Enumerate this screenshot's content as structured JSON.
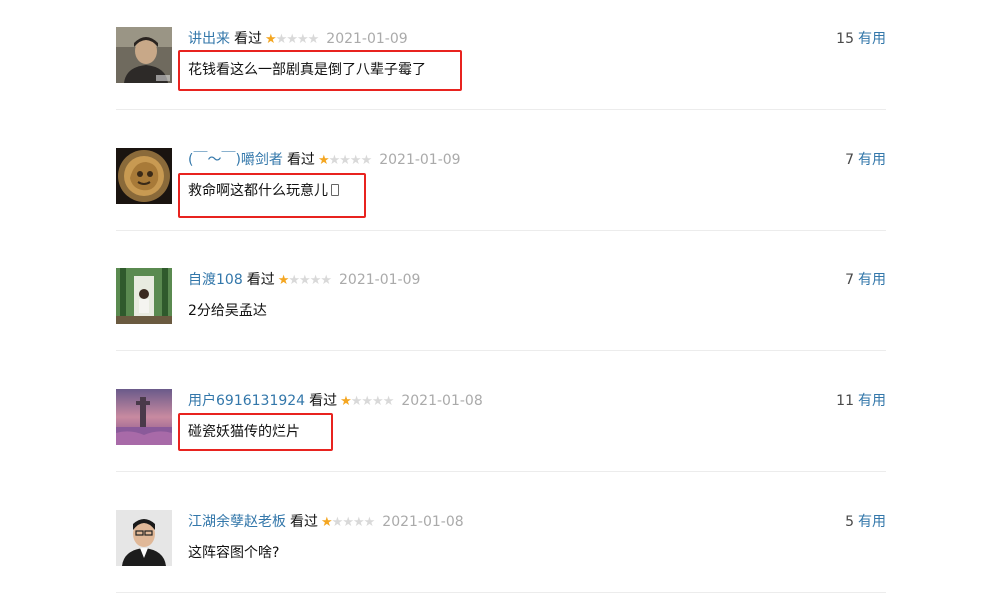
{
  "colors": {
    "link": "#3377aa",
    "star_on": "#f4a621",
    "star_off": "#d9d9d9",
    "date": "#aaaaaa",
    "highlight_box": "#e8231f"
  },
  "icons": {
    "star_filled": "★",
    "star_empty": "★"
  },
  "comments": [
    {
      "username": "讲出来",
      "status": "看过",
      "rating": 1,
      "rating_max": 5,
      "date": "2021-01-09",
      "useful_count": "15",
      "useful_label": "有用",
      "content": "花钱看这么一部剧真是倒了八辈子霉了",
      "highlighted": true
    },
    {
      "username": "(￣～￣)嚼剑者",
      "status": "看过",
      "rating": 1,
      "rating_max": 5,
      "date": "2021-01-09",
      "useful_count": "7",
      "useful_label": "有用",
      "content": "救命啊这都什么玩意儿",
      "highlighted": true
    },
    {
      "username": "自渡108",
      "status": "看过",
      "rating": 1,
      "rating_max": 5,
      "date": "2021-01-09",
      "useful_count": "7",
      "useful_label": "有用",
      "content": "2分给吴孟达",
      "highlighted": false
    },
    {
      "username": "用户6916131924",
      "status": "看过",
      "rating": 1,
      "rating_max": 5,
      "date": "2021-01-08",
      "useful_count": "11",
      "useful_label": "有用",
      "content": "碰瓷妖猫传的烂片",
      "highlighted": true
    },
    {
      "username": "江湖余孽赵老板",
      "status": "看过",
      "rating": 1,
      "rating_max": 5,
      "date": "2021-01-08",
      "useful_count": "5",
      "useful_label": "有用",
      "content": "这阵容图个啥?",
      "highlighted": false
    }
  ]
}
